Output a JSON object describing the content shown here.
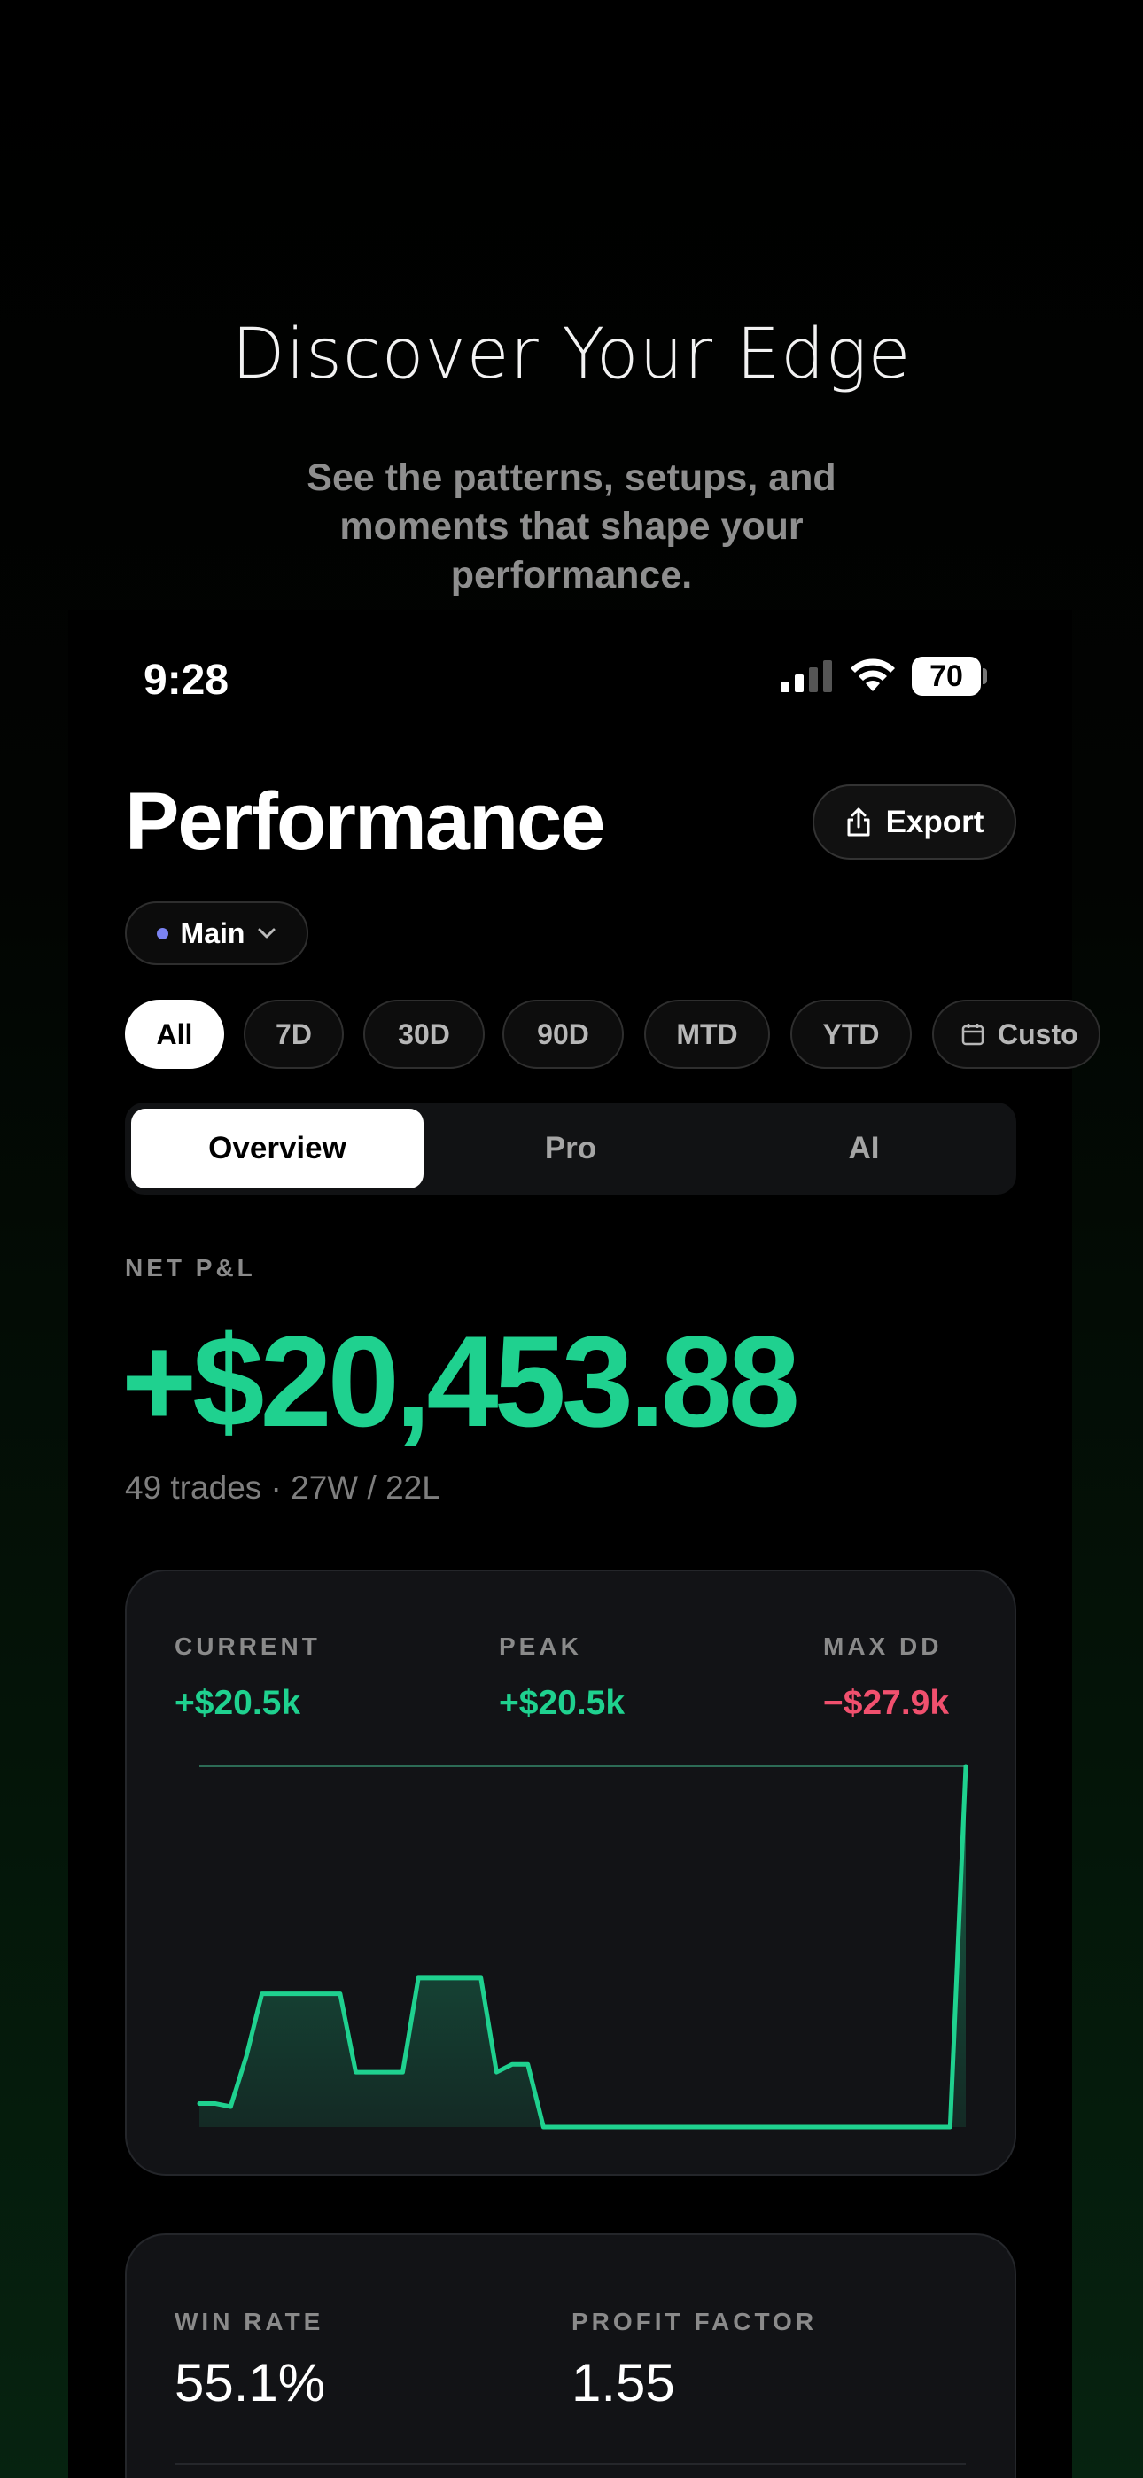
{
  "hero": {
    "title": "Discover Your Edge",
    "subtitle": "See the patterns, setups, and moments that shape your performance."
  },
  "status_bar": {
    "time": "9:28",
    "battery": "70",
    "icons": [
      "signal-icon",
      "wifi-icon",
      "battery-icon"
    ]
  },
  "header": {
    "title": "Performance",
    "export_label": "Export",
    "export_icon": "share-icon"
  },
  "account": {
    "label": "Main",
    "dot_color": "#7b83f2",
    "icon": "chevron-down-icon"
  },
  "ranges": [
    {
      "label": "All",
      "active": true
    },
    {
      "label": "7D",
      "active": false
    },
    {
      "label": "30D",
      "active": false
    },
    {
      "label": "90D",
      "active": false
    },
    {
      "label": "MTD",
      "active": false
    },
    {
      "label": "YTD",
      "active": false
    },
    {
      "label": "Custo",
      "active": false,
      "icon": "calendar-icon"
    }
  ],
  "tabs": [
    {
      "label": "Overview",
      "active": true
    },
    {
      "label": "Pro",
      "active": false
    },
    {
      "label": "AI",
      "active": false
    }
  ],
  "pnl": {
    "label": "NET P&L",
    "value": "+$20,453.88",
    "sub": "49 trades · 27W / 22L"
  },
  "equity": {
    "current_label": "CURRENT",
    "current_value": "+$20.5k",
    "peak_label": "PEAK",
    "peak_value": "+$20.5k",
    "maxdd_label": "MAX DD",
    "maxdd_value": "−$27.9k"
  },
  "stats": {
    "winrate_label": "WIN RATE",
    "winrate_value": "55.1%",
    "profit_factor_label": "PROFIT FACTOR",
    "profit_factor_value": "1.55"
  },
  "colors": {
    "accent_green": "#1fd18f",
    "negative_red": "#f0506e",
    "background": "#000000",
    "card": "#121316"
  },
  "chart_data": {
    "type": "area",
    "title": "",
    "xlabel": "",
    "ylabel": "",
    "x": [
      0,
      1,
      2,
      3,
      4,
      5,
      6,
      7,
      8,
      9,
      10,
      11,
      12,
      13,
      14,
      15,
      16,
      17,
      18,
      19,
      20,
      21,
      22,
      23,
      24,
      25,
      26,
      27,
      28,
      29,
      30,
      31,
      32,
      33,
      34,
      35,
      36,
      37,
      38,
      39,
      40,
      41,
      42,
      43,
      44,
      45,
      46,
      47,
      48,
      49
    ],
    "series": [
      {
        "values": [
          -1.0,
          -1.0,
          -1.2,
          2.0,
          6.0,
          6.0,
          6.0,
          6.0,
          6.0,
          6.0,
          1.0,
          1.0,
          1.0,
          1.0,
          7.0,
          7.0,
          7.0,
          7.0,
          7.0,
          1.0,
          1.5,
          1.5,
          -2.5,
          -2.5,
          -2.5,
          -2.5,
          -2.5,
          -2.5,
          -2.5,
          -2.5,
          -2.5,
          -2.5,
          -2.5,
          -2.5,
          -2.5,
          -2.5,
          -2.5,
          -2.5,
          -2.5,
          -2.5,
          -2.5,
          -2.5,
          -2.5,
          -2.5,
          -2.5,
          -2.5,
          -2.5,
          -2.5,
          -2.5,
          20.5
        ]
      }
    ]
  }
}
